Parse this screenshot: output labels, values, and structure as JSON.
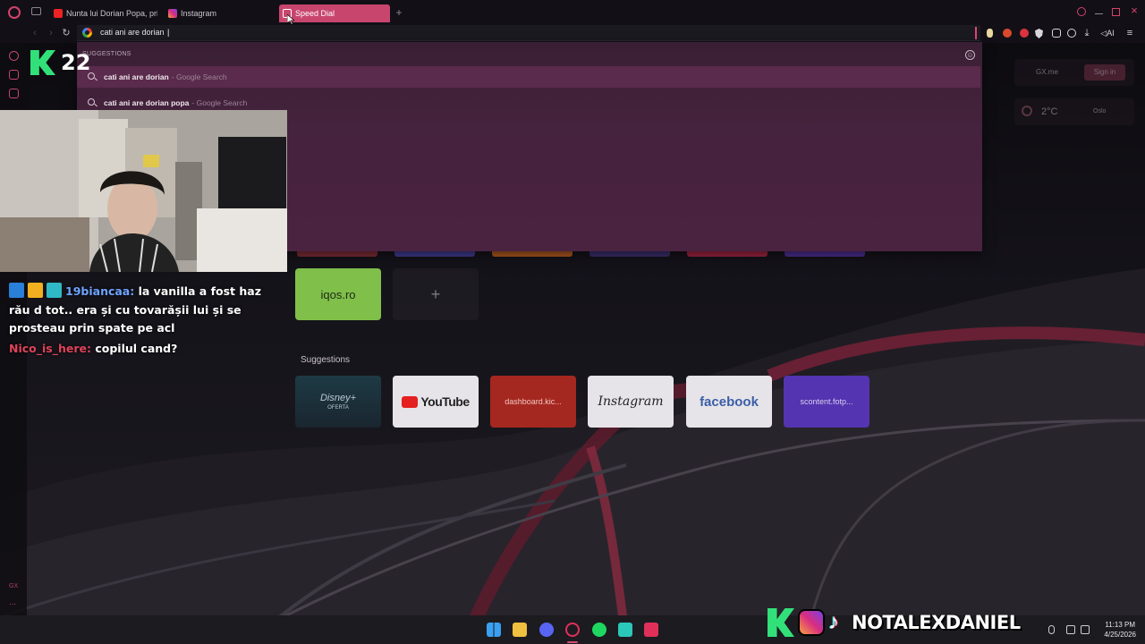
{
  "browser": {
    "tabs": [
      {
        "title": "Nunta lui Dorian Popa, pri",
        "favicon": "youtube-icon",
        "active": false
      },
      {
        "title": "Instagram",
        "favicon": "instagram-icon",
        "active": false
      },
      {
        "title": "Speed Dial",
        "favicon": "speed-dial-icon",
        "active": true
      }
    ],
    "new_tab_label": "+",
    "address_value": "cati ani are dorian ",
    "accent_color": "#c8456e"
  },
  "suggestions": {
    "header": "SUGGESTIONS",
    "items": [
      {
        "query": "cati ani are dorian",
        "source": "- Google Search"
      },
      {
        "query": "cati ani are dorian popa",
        "source": "- Google Search"
      }
    ]
  },
  "overlay": {
    "brand_number": "22",
    "social_handle": "NOTALEXDANIEL"
  },
  "chat": {
    "messages": [
      {
        "user": "19biancaa:",
        "text": "la vanilla a fost haz rău d tot.. era și cu tovarășii lui și se prosteau prin spate pe acl"
      },
      {
        "user": "Nico_is_here:",
        "text": "copilul cand?"
      }
    ]
  },
  "speed_dial": {
    "tiles": [
      {
        "label": "iqos.ro"
      }
    ],
    "add_label": "+",
    "suggestions_label": "Suggestions",
    "suggested": [
      {
        "label": "Disney+",
        "sublabel": "OFERTA"
      },
      {
        "label": "YouTube"
      },
      {
        "label": "dashboard.kic..."
      },
      {
        "label": "Instagram"
      },
      {
        "label": "facebook"
      },
      {
        "label": "scontent.fotp..."
      }
    ]
  },
  "widgets": {
    "gx_me": "GX.me",
    "sign_in": "Sign in",
    "temperature": "2°C",
    "city": "Oslo"
  },
  "sidebar": {
    "gx_label": "GX",
    "more_label": "..."
  },
  "taskbar": {
    "time": "11:13 PM",
    "date": "4/25/2026"
  }
}
